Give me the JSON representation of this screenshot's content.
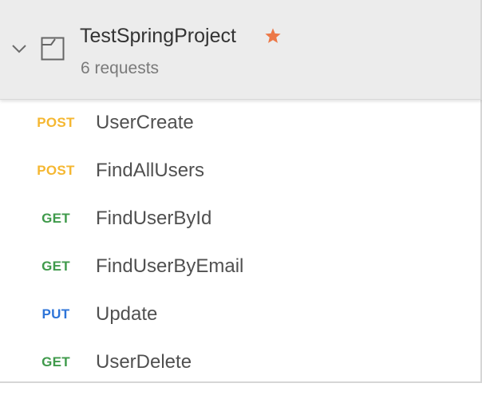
{
  "collection": {
    "name": "TestSpringProject",
    "request_count": "6 requests",
    "favorited": true,
    "expanded": true
  },
  "method_colors": {
    "POST": "#f5b731",
    "GET": "#3f9a4b",
    "PUT": "#2d74d8"
  },
  "requests": [
    {
      "method": "POST",
      "name": "UserCreate"
    },
    {
      "method": "POST",
      "name": "FindAllUsers"
    },
    {
      "method": "GET",
      "name": "FindUserById"
    },
    {
      "method": "GET",
      "name": "FindUserByEmail"
    },
    {
      "method": "PUT",
      "name": "Update"
    },
    {
      "method": "GET",
      "name": "UserDelete"
    }
  ],
  "icons": {
    "chevron": "chevron-down-icon",
    "folder": "collection-folder-icon",
    "star": "star-icon",
    "star_color": "#ec7847"
  }
}
